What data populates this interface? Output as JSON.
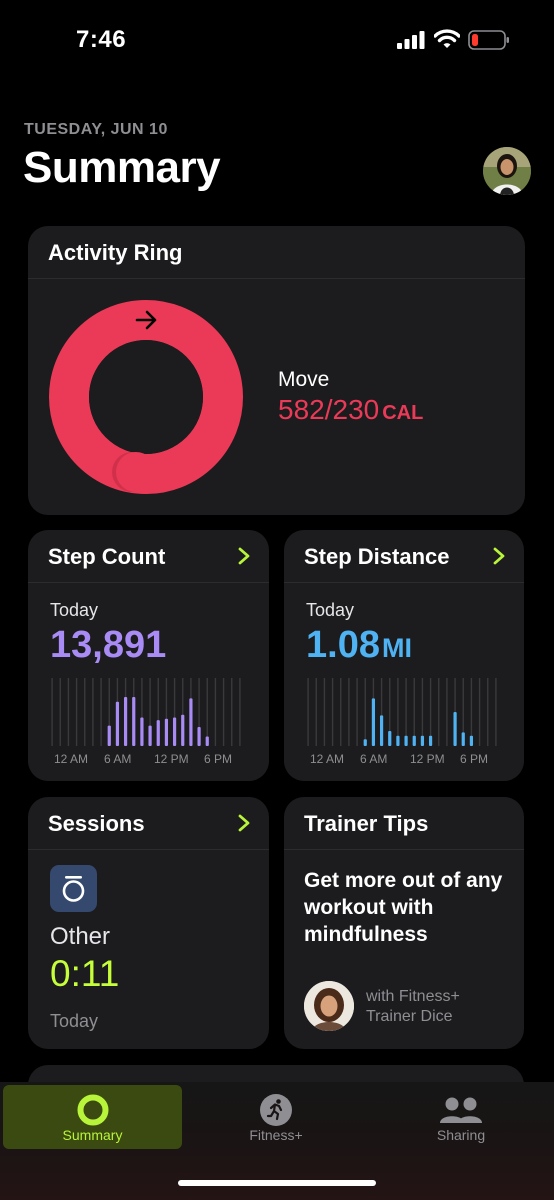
{
  "status": {
    "time": "7:46"
  },
  "header": {
    "date": "TUESDAY, JUN 10",
    "title": "Summary"
  },
  "activity": {
    "title": "Activity Ring",
    "move_label": "Move",
    "move_value": "582/230",
    "move_unit": "CAL",
    "ring_color": "#ea3a57",
    "ring_fraction": 2.53
  },
  "steps": {
    "title": "Step Count",
    "today": "Today",
    "value": "13,891",
    "color": "#a98bf5",
    "chart_data": {
      "type": "bar",
      "x": [
        "12 AM",
        "6 AM",
        "12 PM",
        "6 PM"
      ],
      "values": [
        0,
        0,
        0,
        0,
        0,
        0,
        0,
        0.3,
        0.65,
        0.72,
        0.72,
        0.42,
        0.3,
        0.38,
        0.4,
        0.42,
        0.46,
        0.7,
        0.28,
        0.14,
        0,
        0,
        0,
        0
      ]
    }
  },
  "distance": {
    "title": "Step Distance",
    "today": "Today",
    "value": "1.08",
    "unit": "MI",
    "color": "#4fb2f2",
    "chart_data": {
      "type": "bar",
      "x": [
        "12 AM",
        "6 AM",
        "12 PM",
        "6 PM"
      ],
      "values": [
        0,
        0,
        0,
        0,
        0,
        0,
        0,
        0.1,
        0.7,
        0.45,
        0.22,
        0.15,
        0.15,
        0.15,
        0.15,
        0.15,
        0,
        0,
        0.5,
        0.2,
        0.15,
        0,
        0,
        0
      ]
    }
  },
  "sessions": {
    "title": "Sessions",
    "name": "Other",
    "value": "0:11",
    "day": "Today"
  },
  "tips": {
    "title": "Trainer Tips",
    "text": "Get more out of any workout with mindfulness",
    "by_line1": "with Fitness+",
    "by_line2": "Trainer Dice"
  },
  "tabs": [
    {
      "label": "Summary",
      "icon": "activity-ring-icon",
      "active": true
    },
    {
      "label": "Fitness+",
      "icon": "fitness-runner-icon",
      "active": false
    },
    {
      "label": "Sharing",
      "icon": "sharing-people-icon",
      "active": false
    }
  ],
  "accent": "#b8f53a"
}
